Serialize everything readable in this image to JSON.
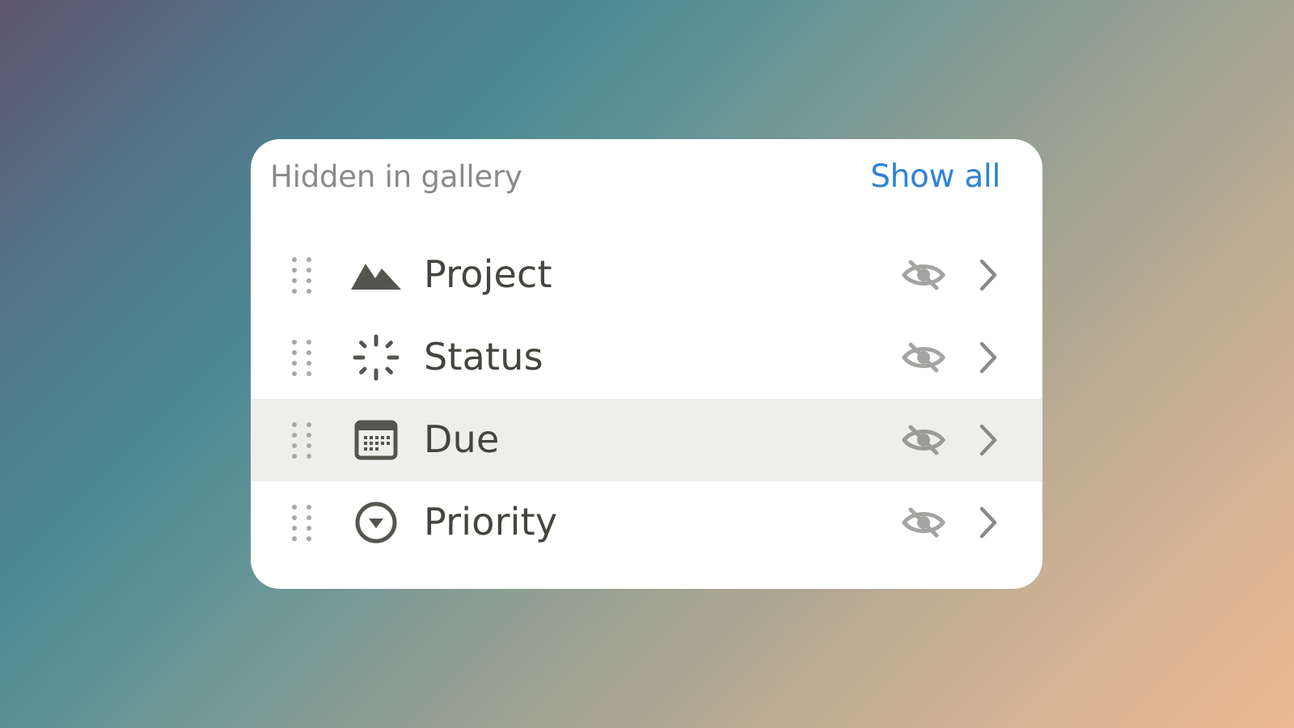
{
  "panel": {
    "title": "Hidden in gallery",
    "show_all_label": "Show all"
  },
  "properties": [
    {
      "label": "Project",
      "icon": "mountain-icon",
      "highlighted": false
    },
    {
      "label": "Status",
      "icon": "loading-spinner-icon",
      "highlighted": false
    },
    {
      "label": "Due",
      "icon": "calendar-icon",
      "highlighted": true
    },
    {
      "label": "Priority",
      "icon": "chevron-circle-icon",
      "highlighted": false
    }
  ],
  "colors": {
    "accent": "#2f83d6",
    "icon": "#55554f",
    "muted_icon": "#9a9a98",
    "row_highlight": "#eeeeed"
  }
}
